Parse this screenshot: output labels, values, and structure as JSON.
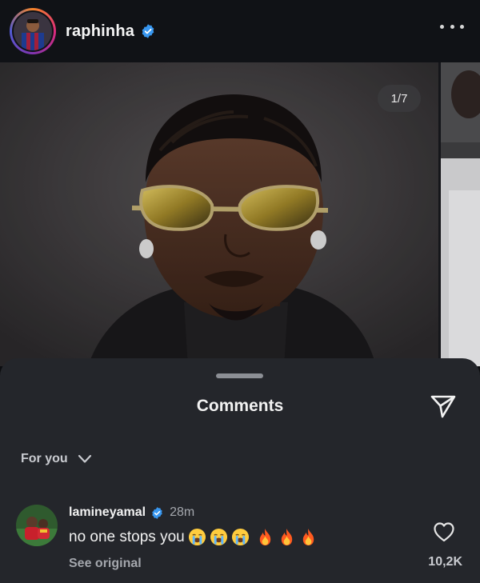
{
  "header": {
    "username": "raphinha",
    "verified": true,
    "more_icon": "more-horizontal-icon"
  },
  "carousel": {
    "counter": "1/7"
  },
  "comments_sheet": {
    "title": "Comments",
    "share_icon": "send-icon",
    "sort": {
      "label": "For you",
      "icon": "chevron-down-icon"
    },
    "comments": [
      {
        "username": "lamineyamal",
        "verified": true,
        "time": "28m",
        "text": "no one stops you",
        "emojis": [
          "loudly-crying-face",
          "loudly-crying-face",
          "loudly-crying-face",
          "fire",
          "fire",
          "fire"
        ],
        "see_original": "See original",
        "likes": "10,2K",
        "like_icon": "heart-outline-icon"
      }
    ]
  },
  "colors": {
    "sheet_bg": "#24262b",
    "header_bg": "#101216",
    "verified_blue": "#3897f0",
    "muted_text": "#a4a7ad"
  }
}
